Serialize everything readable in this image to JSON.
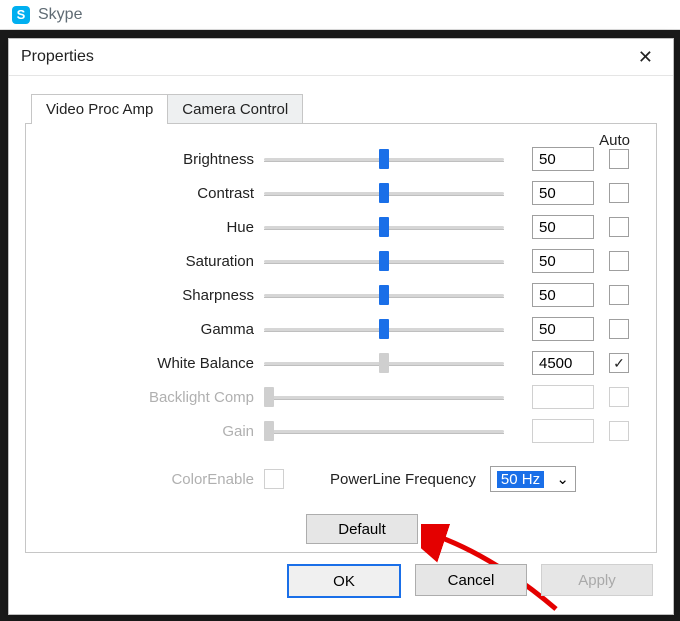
{
  "skype": {
    "appName": "Skype",
    "logoLetter": "S"
  },
  "dialog": {
    "title": "Properties",
    "tabs": {
      "videoProcAmp": "Video Proc Amp",
      "cameraControl": "Camera Control"
    },
    "autoHeader": "Auto",
    "rows": [
      {
        "label": "Brightness",
        "value": "50",
        "pos": 50,
        "disabled": false,
        "auto": false,
        "autoDisabled": false
      },
      {
        "label": "Contrast",
        "value": "50",
        "pos": 50,
        "disabled": false,
        "auto": false,
        "autoDisabled": false
      },
      {
        "label": "Hue",
        "value": "50",
        "pos": 50,
        "disabled": false,
        "auto": false,
        "autoDisabled": false
      },
      {
        "label": "Saturation",
        "value": "50",
        "pos": 50,
        "disabled": false,
        "auto": false,
        "autoDisabled": false
      },
      {
        "label": "Sharpness",
        "value": "50",
        "pos": 50,
        "disabled": false,
        "auto": false,
        "autoDisabled": false
      },
      {
        "label": "Gamma",
        "value": "50",
        "pos": 50,
        "disabled": false,
        "auto": false,
        "autoDisabled": false
      },
      {
        "label": "White Balance",
        "value": "4500",
        "pos": 50,
        "disabled": false,
        "thumbDisabled": true,
        "auto": true,
        "autoDisabled": false
      },
      {
        "label": "Backlight Comp",
        "value": "",
        "pos": 2,
        "disabled": true,
        "auto": false,
        "autoDisabled": true
      },
      {
        "label": "Gain",
        "value": "",
        "pos": 2,
        "disabled": true,
        "auto": false,
        "autoDisabled": true
      }
    ],
    "colorEnable": {
      "label": "ColorEnable",
      "checked": false,
      "disabled": true
    },
    "powerline": {
      "label": "PowerLine Frequency",
      "value": "50 Hz"
    },
    "defaultBtn": "Default",
    "buttons": {
      "ok": "OK",
      "cancel": "Cancel",
      "apply": "Apply"
    }
  }
}
